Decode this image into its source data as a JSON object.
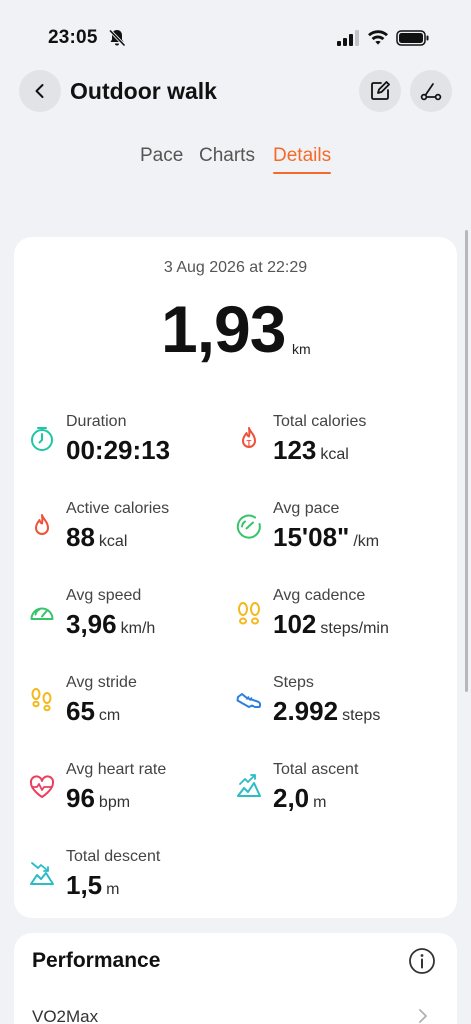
{
  "status_bar": {
    "time": "23:05"
  },
  "header": {
    "title": "Outdoor walk"
  },
  "tabs": [
    {
      "label": "Pace"
    },
    {
      "label": "Charts"
    },
    {
      "label": "Details"
    }
  ],
  "summary": {
    "date": "3 Aug 2026 at 22:29",
    "distance": "1,93",
    "distance_unit": "km"
  },
  "metrics": [
    {
      "label": "Duration",
      "value": "00:29:13",
      "unit": "",
      "icon": "stopwatch-icon"
    },
    {
      "label": "Total calories",
      "value": "123",
      "unit": "kcal",
      "icon": "total-calories-flame-icon"
    },
    {
      "label": "Active calories",
      "value": "88",
      "unit": "kcal",
      "icon": "flame-icon"
    },
    {
      "label": "Avg pace",
      "value": "15'08\"",
      "unit": "/km",
      "icon": "pace-gauge-icon"
    },
    {
      "label": "Avg speed",
      "value": "3,96",
      "unit": "km/h",
      "icon": "speedometer-icon"
    },
    {
      "label": "Avg cadence",
      "value": "102",
      "unit": "steps/min",
      "icon": "footprints-icon"
    },
    {
      "label": "Avg stride",
      "value": "65",
      "unit": "cm",
      "icon": "stride-footprints-icon"
    },
    {
      "label": "Steps",
      "value": "2.992",
      "unit": "steps",
      "icon": "shoe-icon"
    },
    {
      "label": "Avg heart rate",
      "value": "96",
      "unit": "bpm",
      "icon": "heart-rate-icon"
    },
    {
      "label": "Total ascent",
      "value": "2,0",
      "unit": "m",
      "icon": "ascent-icon"
    },
    {
      "label": "Total descent",
      "value": "1,5",
      "unit": "m",
      "icon": "descent-icon"
    }
  ],
  "performance": {
    "title": "Performance",
    "vo2_label": "VO2Max"
  },
  "colors": {
    "accent": "#f36b2a",
    "teal": "#1fc6a4",
    "red": "#f0513b",
    "green": "#36c46a",
    "yellow": "#f4b81b",
    "blue": "#2d7fe0",
    "pink": "#ec3f5f",
    "cyan": "#2bbcc4"
  }
}
